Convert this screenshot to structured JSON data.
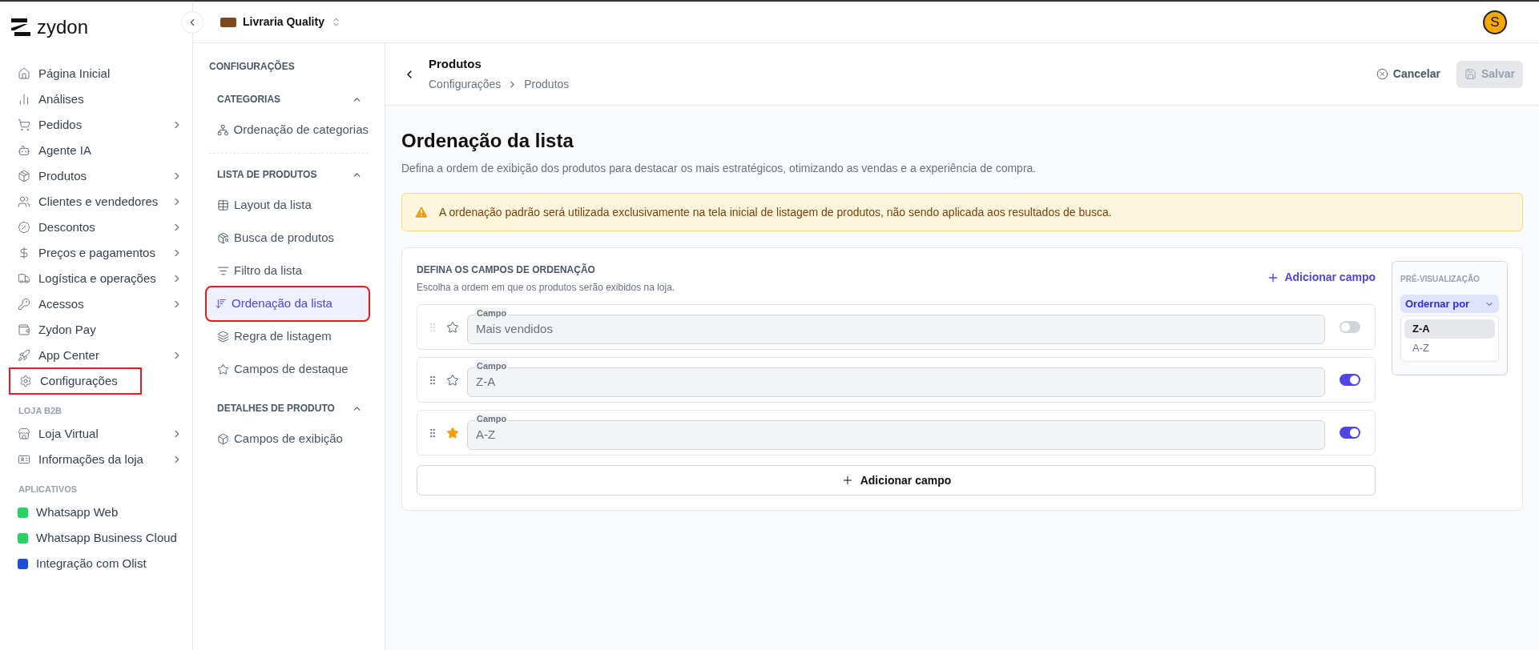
{
  "brand": {
    "name": "zydon"
  },
  "store": {
    "name": "Livraria Quality"
  },
  "user": {
    "initial": "S"
  },
  "nav_sections": [
    {
      "items": [
        {
          "label": "Página Inicial",
          "has_submenu": false,
          "highlighted": false
        },
        {
          "label": "Análises",
          "has_submenu": false,
          "highlighted": false
        },
        {
          "label": "Pedidos",
          "has_submenu": true,
          "highlighted": false
        },
        {
          "label": "Agente IA",
          "has_submenu": false,
          "highlighted": false
        },
        {
          "label": "Produtos",
          "has_submenu": true,
          "highlighted": false
        },
        {
          "label": "Clientes e vendedores",
          "has_submenu": true,
          "highlighted": false
        },
        {
          "label": "Descontos",
          "has_submenu": true,
          "highlighted": false
        },
        {
          "label": "Preços e pagamentos",
          "has_submenu": true,
          "highlighted": false
        },
        {
          "label": "Logística e operações",
          "has_submenu": true,
          "highlighted": false
        },
        {
          "label": "Acessos",
          "has_submenu": true,
          "highlighted": false
        },
        {
          "label": "Zydon Pay",
          "has_submenu": false,
          "highlighted": false
        },
        {
          "label": "App Center",
          "has_submenu": true,
          "highlighted": false
        },
        {
          "label": "Configurações",
          "has_submenu": false,
          "highlighted": true
        }
      ]
    },
    {
      "heading": "LOJA B2B",
      "items": [
        {
          "label": "Loja Virtual",
          "has_submenu": true,
          "highlighted": false
        },
        {
          "label": "Informações da loja",
          "has_submenu": true,
          "highlighted": false
        }
      ]
    },
    {
      "heading": "APLICATIVOS",
      "items": [
        {
          "label": "Whatsapp Web",
          "has_submenu": false,
          "highlighted": false,
          "color": "#25d366"
        },
        {
          "label": "Whatsapp Business Cloud",
          "has_submenu": false,
          "highlighted": false,
          "color": "#25d366"
        },
        {
          "label": "Integração com Olist",
          "has_submenu": false,
          "highlighted": false,
          "color": "#1d4ed8"
        }
      ]
    }
  ],
  "settings": {
    "title": "CONFIGURAÇÕES",
    "groups": [
      {
        "heading": "CATEGORIAS",
        "expanded": true,
        "items": [
          {
            "label": "Ordenação de categorias",
            "selected": false,
            "highlighted": false
          }
        ]
      },
      {
        "heading": "LISTA DE PRODUTOS",
        "expanded": true,
        "items": [
          {
            "label": "Layout da lista",
            "selected": false,
            "highlighted": false
          },
          {
            "label": "Busca de produtos",
            "selected": false,
            "highlighted": false
          },
          {
            "label": "Filtro da lista",
            "selected": false,
            "highlighted": false
          },
          {
            "label": "Ordenação da lista",
            "selected": true,
            "highlighted": true
          },
          {
            "label": "Regra de listagem",
            "selected": false,
            "highlighted": false
          },
          {
            "label": "Campos de destaque",
            "selected": false,
            "highlighted": false
          }
        ]
      },
      {
        "heading": "DETALHES DE PRODUTO",
        "expanded": true,
        "items": [
          {
            "label": "Campos de exibição",
            "selected": false,
            "highlighted": false
          }
        ]
      }
    ]
  },
  "header": {
    "title": "Produtos",
    "breadcrumb": [
      "Configurações",
      "Produtos"
    ],
    "cancel": "Cancelar",
    "save": {
      "label": "Salvar",
      "disabled": true
    }
  },
  "page": {
    "title": "Ordenação da lista",
    "description": "Defina a ordem de exibição dos produtos para destacar os mais estratégicos, otimizando as vendas e a experiência de compra.",
    "warning": "A ordenação padrão será utilizada exclusivamente na tela inicial de listagem de produtos, não sendo aplicada aos resultados de busca.",
    "card": {
      "heading": "DEFINA OS CAMPOS DE ORDENAÇÃO",
      "subheading": "Escolha a ordem em que os produtos serão exibidos na loja.",
      "add_link": "Adicionar campo",
      "fields": [
        {
          "label": "Campo",
          "value": "Mais vendidos",
          "starred": false,
          "on": false
        },
        {
          "label": "Campo",
          "value": "Z-A",
          "starred": false,
          "on": true
        },
        {
          "label": "Campo",
          "value": "A-Z",
          "starred": true,
          "on": true
        }
      ],
      "add_button": "Adicionar campo"
    },
    "preview": {
      "title": "PRÉ-VISUALIZAÇÃO",
      "dropdown": "Ordernar por",
      "options": [
        {
          "label": "Z-A",
          "selected": true
        },
        {
          "label": "A-Z",
          "selected": false
        }
      ]
    }
  }
}
